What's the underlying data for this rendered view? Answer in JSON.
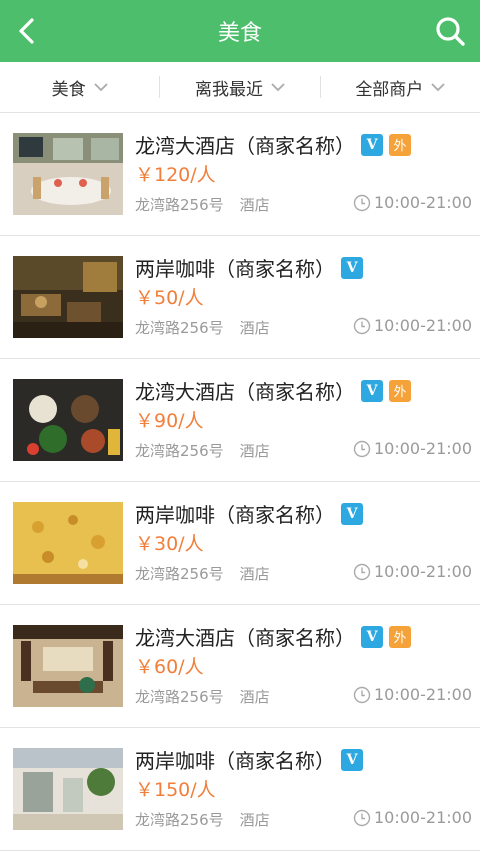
{
  "header": {
    "title": "美食"
  },
  "filters": [
    {
      "label": "美食"
    },
    {
      "label": "离我最近"
    },
    {
      "label": "全部商户"
    }
  ],
  "items": [
    {
      "name": "龙湾大酒店（商家名称）",
      "badge_v": "V",
      "badge_out": "外",
      "price": "￥120/人",
      "address": "龙湾路256号",
      "category": "酒店",
      "hours": "10:00-21:00",
      "image": "restaurant-dining-room"
    },
    {
      "name": "两岸咖啡（商家名称）",
      "badge_v": "V",
      "price": "￥50/人",
      "address": "龙湾路256号",
      "category": "酒店",
      "hours": "10:00-21:00",
      "image": "cafe-lounge"
    },
    {
      "name": "龙湾大酒店（商家名称）",
      "badge_v": "V",
      "badge_out": "外",
      "price": "￥90/人",
      "address": "龙湾路256号",
      "category": "酒店",
      "hours": "10:00-21:00",
      "image": "food-dish"
    },
    {
      "name": "两岸咖啡（商家名称）",
      "badge_v": "V",
      "price": "￥30/人",
      "address": "龙湾路256号",
      "category": "酒店",
      "hours": "10:00-21:00",
      "image": "pizza"
    },
    {
      "name": "龙湾大酒店（商家名称）",
      "badge_v": "V",
      "badge_out": "外",
      "price": "￥60/人",
      "address": "龙湾路256号",
      "category": "酒店",
      "hours": "10:00-21:00",
      "image": "restaurant-interior"
    },
    {
      "name": "两岸咖啡（商家名称）",
      "badge_v": "V",
      "price": "￥150/人",
      "address": "龙湾路256号",
      "category": "酒店",
      "hours": "10:00-21:00",
      "image": "storefront"
    }
  ],
  "colors": {
    "header": "#4dbf6c",
    "price": "#f17f3b",
    "badge_v": "#2ea8e0",
    "badge_out": "#f5a23a"
  }
}
